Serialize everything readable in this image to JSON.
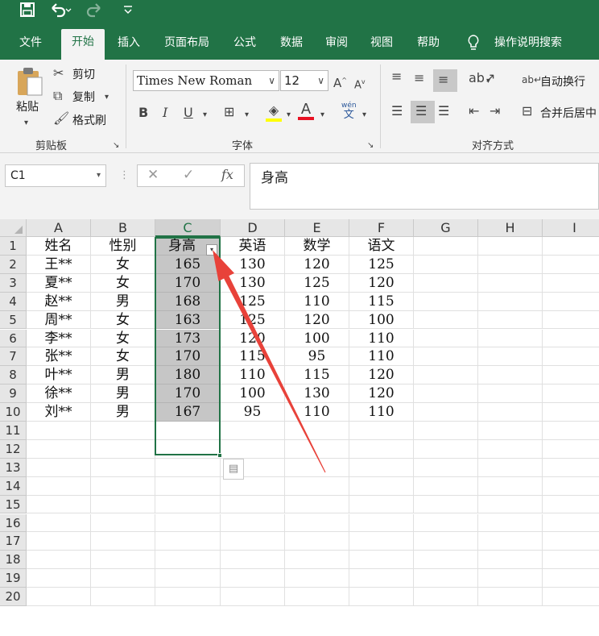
{
  "quick_access": {
    "save_icon": "save-icon",
    "undo_icon": "undo-icon",
    "redo_icon": "redo-icon",
    "customize_icon": "customize-qat-icon"
  },
  "tabs": [
    {
      "label": "文件"
    },
    {
      "label": "开始"
    },
    {
      "label": "插入"
    },
    {
      "label": "页面布局"
    },
    {
      "label": "公式"
    },
    {
      "label": "数据"
    },
    {
      "label": "审阅"
    },
    {
      "label": "视图"
    },
    {
      "label": "帮助"
    },
    {
      "label": "操作说明搜索"
    }
  ],
  "active_tab": "开始",
  "ribbon": {
    "clipboard": {
      "paste": "粘贴",
      "cut": "剪切",
      "copy": "复制",
      "format_painter": "格式刷",
      "group": "剪贴板"
    },
    "font": {
      "name": "Times New Roman",
      "size": "12",
      "bold": "B",
      "italic": "I",
      "underline": "U",
      "font_color_letter": "A",
      "phonetic_top": "wén",
      "phonetic_bottom": "文",
      "group": "字体",
      "grow": "A",
      "shrink": "A"
    },
    "alignment": {
      "wrap_text": "自动换行",
      "merge_center": "合并后居中",
      "group": "对齐方式"
    }
  },
  "formula_bar": {
    "name_box": "C1",
    "content": "身高",
    "fx": "fx"
  },
  "sheet": {
    "columns": [
      "A",
      "B",
      "C",
      "D",
      "E",
      "F",
      "G",
      "H",
      "I"
    ],
    "selected_column": "C",
    "row_numbers": [
      "1",
      "2",
      "3",
      "4",
      "5",
      "6",
      "7",
      "8",
      "9",
      "10",
      "11",
      "12",
      "13",
      "14",
      "15",
      "16",
      "17",
      "18",
      "19",
      "20"
    ],
    "rows": [
      [
        "姓名",
        "性别",
        "身高",
        "英语",
        "数学",
        "语文"
      ],
      [
        "王**",
        "女",
        "165",
        "130",
        "120",
        "125"
      ],
      [
        "夏**",
        "女",
        "170",
        "130",
        "125",
        "120"
      ],
      [
        "赵**",
        "男",
        "168",
        "125",
        "110",
        "115"
      ],
      [
        "周**",
        "女",
        "163",
        "125",
        "120",
        "100"
      ],
      [
        "李**",
        "女",
        "173",
        "120",
        "100",
        "110"
      ],
      [
        "张**",
        "女",
        "170",
        "115",
        "95",
        "110"
      ],
      [
        "叶**",
        "男",
        "180",
        "110",
        "115",
        "120"
      ],
      [
        "徐**",
        "男",
        "170",
        "100",
        "130",
        "120"
      ],
      [
        "刘**",
        "男",
        "167",
        "95",
        "110",
        "110"
      ]
    ]
  },
  "colors": {
    "accent": "#217346",
    "annotation_arrow": "#e8423a"
  }
}
